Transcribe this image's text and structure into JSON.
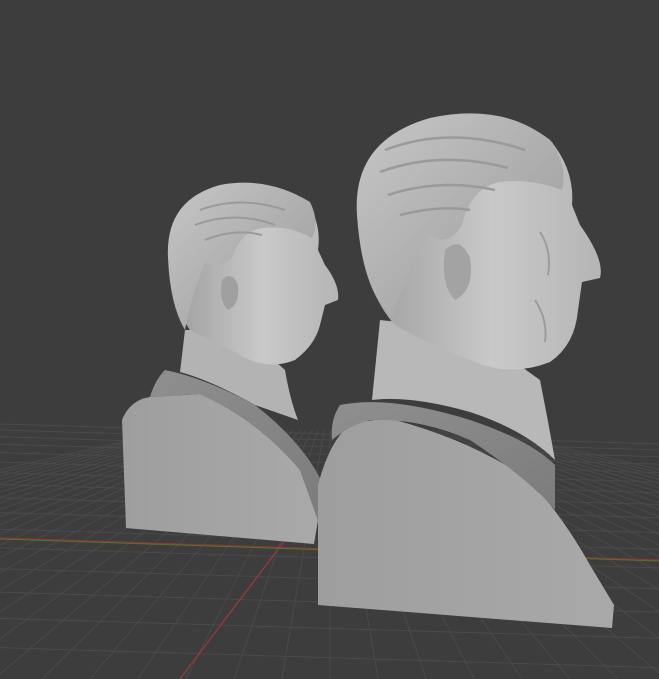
{
  "viewport": {
    "kind": "3d-viewport",
    "background_color": "#3d3d3d",
    "grid_line_color": "#4a4a4a",
    "x_axis_color": "#9c3a3a",
    "y_axis_color": "#5f8a2a"
  },
  "objects": [
    {
      "name": "bust-small",
      "kind": "sculpt-mesh",
      "material_color": "#a6a6a6"
    },
    {
      "name": "bust-large",
      "kind": "sculpt-mesh",
      "material_color": "#a6a6a6"
    }
  ]
}
